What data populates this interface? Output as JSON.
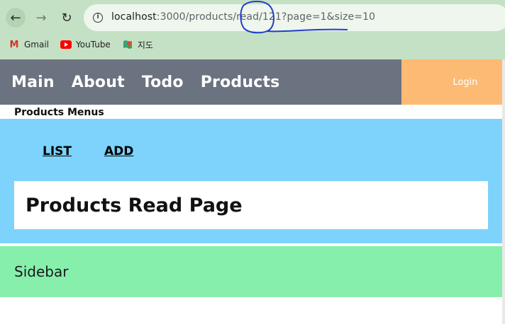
{
  "browser": {
    "back_icon": "arrow-left",
    "forward_icon": "arrow-right",
    "reload_icon": "reload",
    "url_host": "localhost",
    "url_rest": ":3000/products/read/121?page=1&size=10",
    "bookmarks": [
      {
        "label": "Gmail",
        "icon": "gmail-icon"
      },
      {
        "label": "YouTube",
        "icon": "youtube-icon"
      },
      {
        "label": "지도",
        "icon": "maps-icon"
      }
    ]
  },
  "app": {
    "nav": [
      "Main",
      "About",
      "Todo",
      "Products"
    ],
    "login_label": "Login",
    "menus_title": "Products Menus",
    "tabs": [
      "LIST",
      "ADD"
    ],
    "page_heading": "Products Read Page",
    "sidebar_label": "Sidebar"
  },
  "colors": {
    "chrome_bg": "#c5e1c5",
    "topbar_bg": "#6b7280",
    "login_bg": "#fdba74",
    "panel_bg": "#7dd3fc",
    "sidebar_bg": "#86efac",
    "annotation_ink": "#1f3fc8"
  }
}
